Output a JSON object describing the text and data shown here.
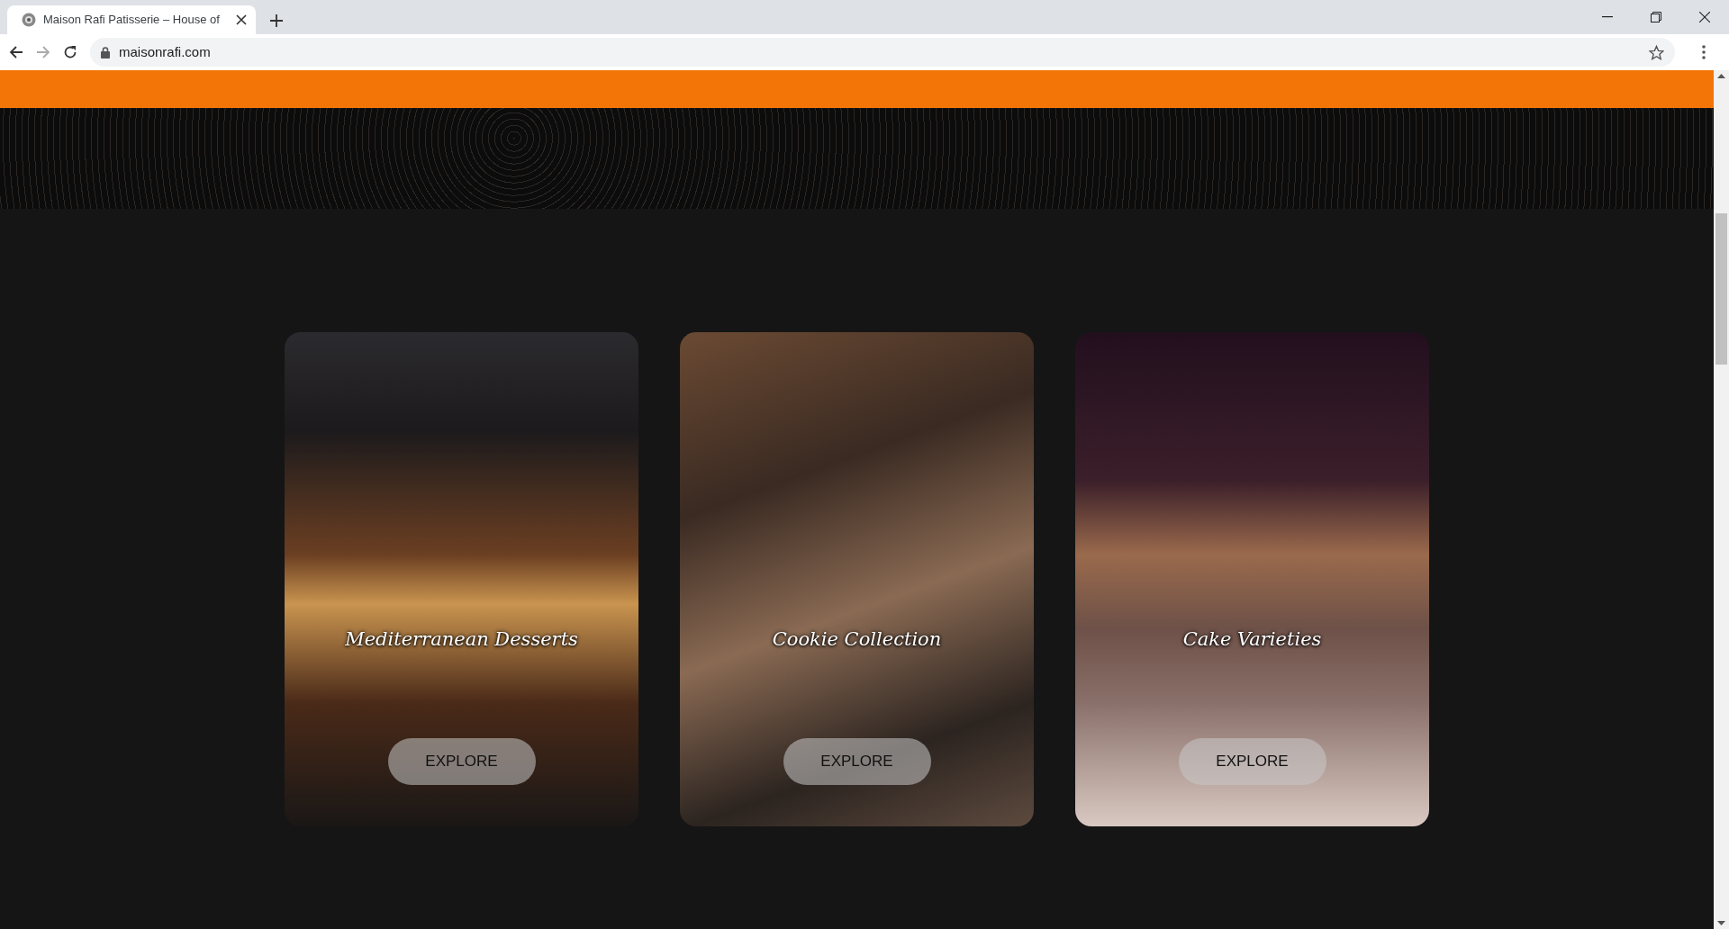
{
  "browser": {
    "tab": {
      "title": "Maison Rafi Patisserie – House of",
      "selected": true
    },
    "address": "maisonrafi.com"
  },
  "categories": [
    {
      "title": "Mediterranean Desserts",
      "button": "EXPLORE"
    },
    {
      "title": "Cookie Collection",
      "button": "EXPLORE"
    },
    {
      "title": "Cake Varieties",
      "button": "EXPLORE"
    }
  ]
}
